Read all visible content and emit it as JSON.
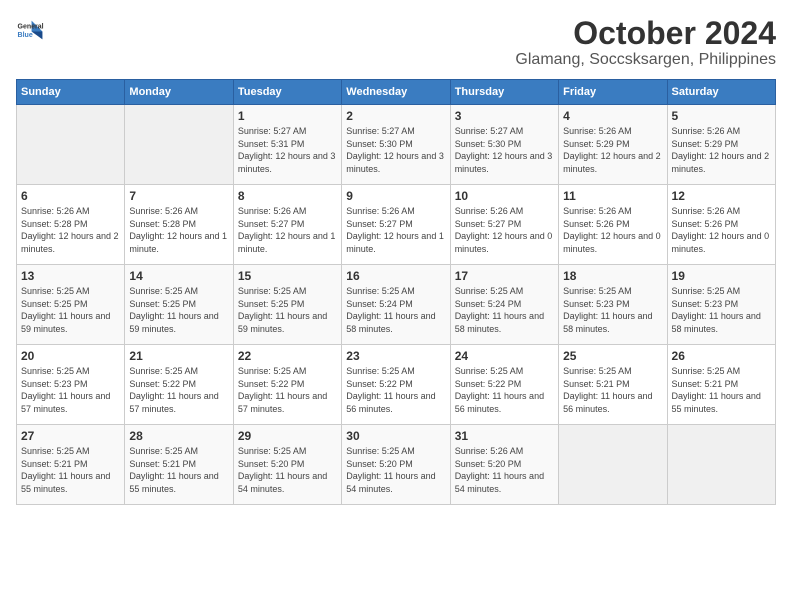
{
  "logo": {
    "text_general": "General",
    "text_blue": "Blue"
  },
  "title": {
    "main": "October 2024",
    "sub": "Glamang, Soccsksargen, Philippines"
  },
  "headers": [
    "Sunday",
    "Monday",
    "Tuesday",
    "Wednesday",
    "Thursday",
    "Friday",
    "Saturday"
  ],
  "weeks": [
    [
      {
        "date": "",
        "sunrise": "",
        "sunset": "",
        "daylight": "",
        "empty": true
      },
      {
        "date": "",
        "sunrise": "",
        "sunset": "",
        "daylight": "",
        "empty": true
      },
      {
        "date": "1",
        "sunrise": "Sunrise: 5:27 AM",
        "sunset": "Sunset: 5:31 PM",
        "daylight": "Daylight: 12 hours and 3 minutes.",
        "empty": false
      },
      {
        "date": "2",
        "sunrise": "Sunrise: 5:27 AM",
        "sunset": "Sunset: 5:30 PM",
        "daylight": "Daylight: 12 hours and 3 minutes.",
        "empty": false
      },
      {
        "date": "3",
        "sunrise": "Sunrise: 5:27 AM",
        "sunset": "Sunset: 5:30 PM",
        "daylight": "Daylight: 12 hours and 3 minutes.",
        "empty": false
      },
      {
        "date": "4",
        "sunrise": "Sunrise: 5:26 AM",
        "sunset": "Sunset: 5:29 PM",
        "daylight": "Daylight: 12 hours and 2 minutes.",
        "empty": false
      },
      {
        "date": "5",
        "sunrise": "Sunrise: 5:26 AM",
        "sunset": "Sunset: 5:29 PM",
        "daylight": "Daylight: 12 hours and 2 minutes.",
        "empty": false
      }
    ],
    [
      {
        "date": "6",
        "sunrise": "Sunrise: 5:26 AM",
        "sunset": "Sunset: 5:28 PM",
        "daylight": "Daylight: 12 hours and 2 minutes.",
        "empty": false
      },
      {
        "date": "7",
        "sunrise": "Sunrise: 5:26 AM",
        "sunset": "Sunset: 5:28 PM",
        "daylight": "Daylight: 12 hours and 1 minute.",
        "empty": false
      },
      {
        "date": "8",
        "sunrise": "Sunrise: 5:26 AM",
        "sunset": "Sunset: 5:27 PM",
        "daylight": "Daylight: 12 hours and 1 minute.",
        "empty": false
      },
      {
        "date": "9",
        "sunrise": "Sunrise: 5:26 AM",
        "sunset": "Sunset: 5:27 PM",
        "daylight": "Daylight: 12 hours and 1 minute.",
        "empty": false
      },
      {
        "date": "10",
        "sunrise": "Sunrise: 5:26 AM",
        "sunset": "Sunset: 5:27 PM",
        "daylight": "Daylight: 12 hours and 0 minutes.",
        "empty": false
      },
      {
        "date": "11",
        "sunrise": "Sunrise: 5:26 AM",
        "sunset": "Sunset: 5:26 PM",
        "daylight": "Daylight: 12 hours and 0 minutes.",
        "empty": false
      },
      {
        "date": "12",
        "sunrise": "Sunrise: 5:26 AM",
        "sunset": "Sunset: 5:26 PM",
        "daylight": "Daylight: 12 hours and 0 minutes.",
        "empty": false
      }
    ],
    [
      {
        "date": "13",
        "sunrise": "Sunrise: 5:25 AM",
        "sunset": "Sunset: 5:25 PM",
        "daylight": "Daylight: 11 hours and 59 minutes.",
        "empty": false
      },
      {
        "date": "14",
        "sunrise": "Sunrise: 5:25 AM",
        "sunset": "Sunset: 5:25 PM",
        "daylight": "Daylight: 11 hours and 59 minutes.",
        "empty": false
      },
      {
        "date": "15",
        "sunrise": "Sunrise: 5:25 AM",
        "sunset": "Sunset: 5:25 PM",
        "daylight": "Daylight: 11 hours and 59 minutes.",
        "empty": false
      },
      {
        "date": "16",
        "sunrise": "Sunrise: 5:25 AM",
        "sunset": "Sunset: 5:24 PM",
        "daylight": "Daylight: 11 hours and 58 minutes.",
        "empty": false
      },
      {
        "date": "17",
        "sunrise": "Sunrise: 5:25 AM",
        "sunset": "Sunset: 5:24 PM",
        "daylight": "Daylight: 11 hours and 58 minutes.",
        "empty": false
      },
      {
        "date": "18",
        "sunrise": "Sunrise: 5:25 AM",
        "sunset": "Sunset: 5:23 PM",
        "daylight": "Daylight: 11 hours and 58 minutes.",
        "empty": false
      },
      {
        "date": "19",
        "sunrise": "Sunrise: 5:25 AM",
        "sunset": "Sunset: 5:23 PM",
        "daylight": "Daylight: 11 hours and 58 minutes.",
        "empty": false
      }
    ],
    [
      {
        "date": "20",
        "sunrise": "Sunrise: 5:25 AM",
        "sunset": "Sunset: 5:23 PM",
        "daylight": "Daylight: 11 hours and 57 minutes.",
        "empty": false
      },
      {
        "date": "21",
        "sunrise": "Sunrise: 5:25 AM",
        "sunset": "Sunset: 5:22 PM",
        "daylight": "Daylight: 11 hours and 57 minutes.",
        "empty": false
      },
      {
        "date": "22",
        "sunrise": "Sunrise: 5:25 AM",
        "sunset": "Sunset: 5:22 PM",
        "daylight": "Daylight: 11 hours and 57 minutes.",
        "empty": false
      },
      {
        "date": "23",
        "sunrise": "Sunrise: 5:25 AM",
        "sunset": "Sunset: 5:22 PM",
        "daylight": "Daylight: 11 hours and 56 minutes.",
        "empty": false
      },
      {
        "date": "24",
        "sunrise": "Sunrise: 5:25 AM",
        "sunset": "Sunset: 5:22 PM",
        "daylight": "Daylight: 11 hours and 56 minutes.",
        "empty": false
      },
      {
        "date": "25",
        "sunrise": "Sunrise: 5:25 AM",
        "sunset": "Sunset: 5:21 PM",
        "daylight": "Daylight: 11 hours and 56 minutes.",
        "empty": false
      },
      {
        "date": "26",
        "sunrise": "Sunrise: 5:25 AM",
        "sunset": "Sunset: 5:21 PM",
        "daylight": "Daylight: 11 hours and 55 minutes.",
        "empty": false
      }
    ],
    [
      {
        "date": "27",
        "sunrise": "Sunrise: 5:25 AM",
        "sunset": "Sunset: 5:21 PM",
        "daylight": "Daylight: 11 hours and 55 minutes.",
        "empty": false
      },
      {
        "date": "28",
        "sunrise": "Sunrise: 5:25 AM",
        "sunset": "Sunset: 5:21 PM",
        "daylight": "Daylight: 11 hours and 55 minutes.",
        "empty": false
      },
      {
        "date": "29",
        "sunrise": "Sunrise: 5:25 AM",
        "sunset": "Sunset: 5:20 PM",
        "daylight": "Daylight: 11 hours and 54 minutes.",
        "empty": false
      },
      {
        "date": "30",
        "sunrise": "Sunrise: 5:25 AM",
        "sunset": "Sunset: 5:20 PM",
        "daylight": "Daylight: 11 hours and 54 minutes.",
        "empty": false
      },
      {
        "date": "31",
        "sunrise": "Sunrise: 5:26 AM",
        "sunset": "Sunset: 5:20 PM",
        "daylight": "Daylight: 11 hours and 54 minutes.",
        "empty": false
      },
      {
        "date": "",
        "sunrise": "",
        "sunset": "",
        "daylight": "",
        "empty": true
      },
      {
        "date": "",
        "sunrise": "",
        "sunset": "",
        "daylight": "",
        "empty": true
      }
    ]
  ]
}
